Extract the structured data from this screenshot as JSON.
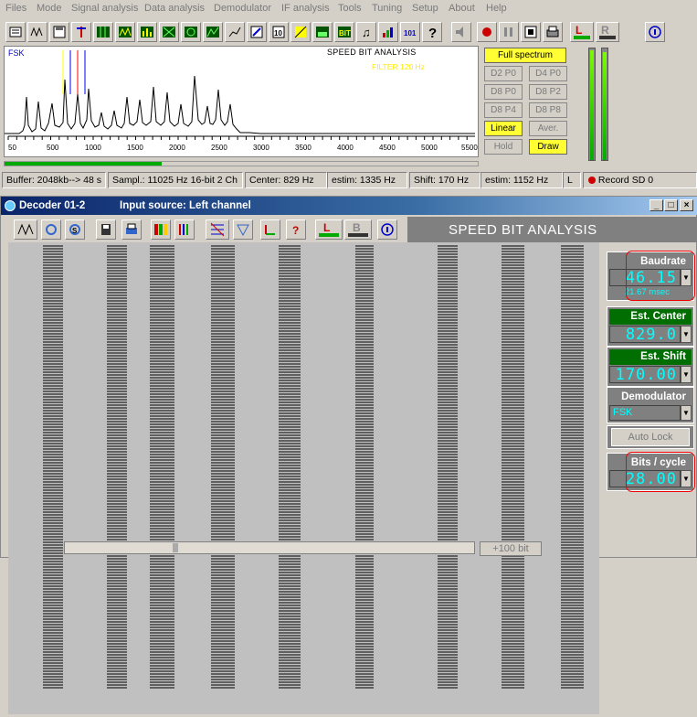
{
  "menubar": {
    "items": [
      "Files",
      "Mode",
      "Signal analysis",
      "Data analysis",
      "Demodulator",
      "IF analysis",
      "Tools",
      "Tuning",
      "Setup",
      "About",
      "Help"
    ]
  },
  "spectrum": {
    "mode_label": "FSK",
    "title": "SPEED BIT ANALYSIS",
    "filter_label": "FILTER 120 Hz",
    "x_ticks": [
      "50",
      "500",
      "1000",
      "1500",
      "2000",
      "2500",
      "3000",
      "3500",
      "4000",
      "4500",
      "5000",
      "5500"
    ]
  },
  "spectrum_buttons": {
    "full_spectrum": "Full spectrum",
    "d2p0": "D2 P0",
    "d4p0": "D4 P0",
    "d8p0": "D8 P0",
    "d8p2": "D8 P2",
    "d8p4": "D8 P4",
    "d8p8": "D8 P8",
    "linear": "Linear",
    "aver": "Aver.",
    "hold": "Hold",
    "draw": "Draw"
  },
  "statusbar": {
    "buffer": "Buffer: 2048kb--> 48 s",
    "sampl": "Sampl.: 11025 Hz 16-bit 2 Ch",
    "center": "Center: 829 Hz",
    "estim1": "estim: 1335 Hz",
    "shift": "Shift: 170 Hz",
    "estim2": "estim: 1152 Hz",
    "channel": "L",
    "record": "Record",
    "sd": "SD 0"
  },
  "decoder": {
    "title": "Decoder 01-2",
    "input_source": "Input source: Left channel",
    "header": "SPEED BIT ANALYSIS",
    "baudrate": {
      "label": "Baudrate",
      "value": "46.15",
      "msec": "21.67 msec"
    },
    "est_center": {
      "label": "Est. Center",
      "value": "829.0"
    },
    "est_shift": {
      "label": "Est. Shift",
      "value": "170.00"
    },
    "demodulator": {
      "label": "Demodulator",
      "value": "FSK"
    },
    "auto_lock": "Auto Lock",
    "bits_cycle": {
      "label": "Bits / cycle",
      "value": "28.00"
    },
    "plus100": "+100 bit"
  },
  "colors": {
    "accent_yellow": "#ffff33",
    "panel_green": "#006e00",
    "value_cyan": "#00ffff",
    "highlight_red": "#e00000"
  }
}
